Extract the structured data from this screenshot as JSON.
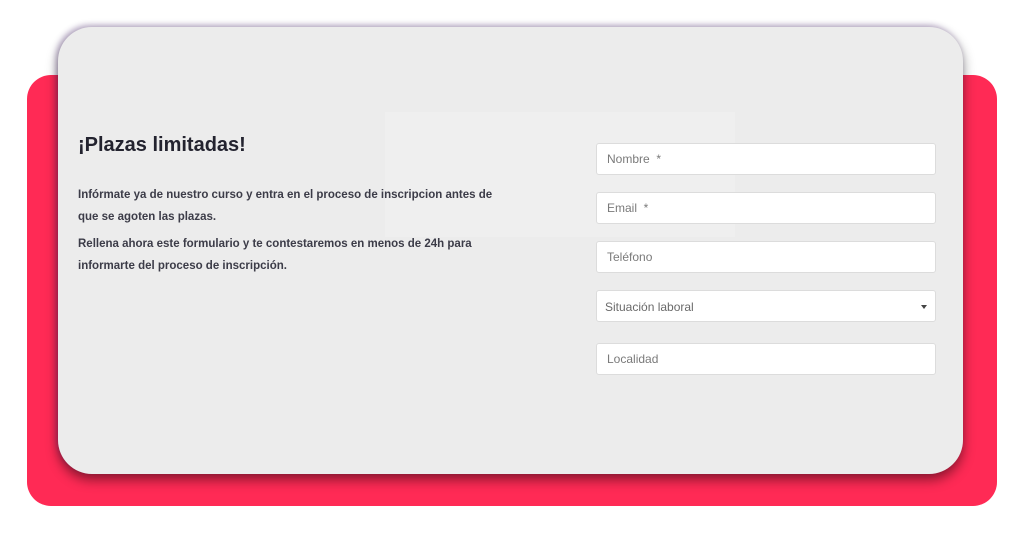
{
  "colors": {
    "accent_red": "#ff2a55",
    "card_gray": "#ececec",
    "title_text": "#23232f"
  },
  "form_section": {
    "title": "¡Plazas limitadas!",
    "paragraph1": "Infórmate ya de nuestro curso y entra en el proceso de inscripcion antes de que se agoten las plazas.",
    "paragraph2": "Rellena ahora este formulario y te contestaremos en menos de 24h para informarte del proceso de inscripción."
  },
  "form": {
    "nombre_placeholder": "Nombre  *",
    "email_placeholder": "Email  *",
    "telefono_placeholder": "Teléfono",
    "situacion_label": "Situación laboral",
    "localidad_placeholder": "Localidad"
  }
}
